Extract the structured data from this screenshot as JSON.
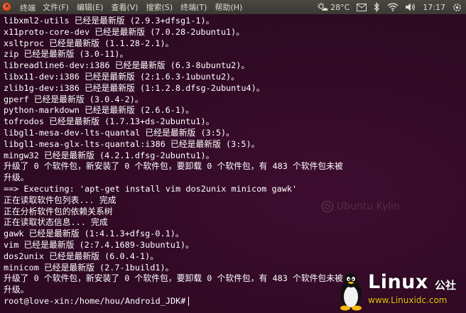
{
  "menubar": {
    "app_title": "终端",
    "menus": [
      {
        "label": "文件(F)"
      },
      {
        "label": "编辑(E)"
      },
      {
        "label": "查看(V)"
      },
      {
        "label": "搜索(S)"
      },
      {
        "label": "终端(T)"
      },
      {
        "label": "帮助(H)"
      }
    ]
  },
  "tray": {
    "weather_temp": "28°C",
    "clock": "17:17",
    "icons": [
      "weather-icon",
      "mail-icon",
      "bluetooth-icon",
      "network-icon",
      "volume-icon",
      "power-gear-icon"
    ]
  },
  "terminal": {
    "lines": [
      "libxml2-utils 已经是最新版 (2.9.3+dfsg1-1)。",
      "x11proto-core-dev 已经是最新版 (7.0.28-2ubuntu1)。",
      "xsltproc 已经是最新版 (1.1.28-2.1)。",
      "zip 已经是最新版 (3.0-11)。",
      "libreadline6-dev:i386 已经是最新版 (6.3-8ubuntu2)。",
      "libx11-dev:i386 已经是最新版 (2:1.6.3-1ubuntu2)。",
      "zlib1g-dev:i386 已经是最新版 (1:1.2.8.dfsg-2ubuntu4)。",
      "gperf 已经是最新版 (3.0.4-2)。",
      "python-markdown 已经是最新版 (2.6.6-1)。",
      "tofrodos 已经是最新版 (1.7.13+ds-2ubuntu1)。",
      "libgl1-mesa-dev-lts-quantal 已经是最新版 (3:5)。",
      "libgl1-mesa-glx-lts-quantal:i386 已经是最新版 (3:5)。",
      "mingw32 已经是最新版 (4.2.1.dfsg-2ubuntu1)。",
      "升级了 0 个软件包，新安装了 0 个软件包，要卸载 0 个软件包，有 483 个软件包未被",
      "升级。",
      "==> Executing: 'apt-get install vim dos2unix minicom gawk'",
      "正在读取软件包列表... 完成",
      "正在分析软件包的依赖关系树",
      "正在读取状态信息... 完成",
      "gawk 已经是最新版 (1:4.1.3+dfsg-0.1)。",
      "vim 已经是最新版 (2:7.4.1689-3ubuntu1)。",
      "dos2unix 已经是最新版 (6.0.4-1)。",
      "minicom 已经是最新版 (2.7-1build1)。",
      "升级了 0 个软件包，新安装了 0 个软件包，要卸载 0 个软件包，有 483 个软件包未被",
      "升级。"
    ],
    "prompt": "root@love-xin:/home/hou/Android_JDK#"
  },
  "watermark": {
    "text": "Ubuntu Kylin"
  },
  "site_logo": {
    "word": "Linux",
    "suffix": "公社",
    "url": "www.Linuxidc.com"
  },
  "colors": {
    "terminal_bg": "#300a24",
    "text": "#ffffff",
    "panel_bg": "#3c3b37",
    "close_button": "#e95420",
    "url_yellow": "#f1c40f"
  }
}
